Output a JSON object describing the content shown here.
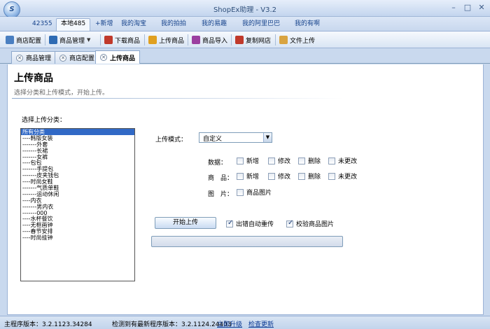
{
  "window": {
    "title": "ShopEx助理 - V3.2",
    "logo_text": ""
  },
  "menu": {
    "items": [
      {
        "label": "42355"
      },
      {
        "label": "本地485"
      },
      {
        "label": "+新增"
      },
      {
        "label": "我的淘宝"
      },
      {
        "label": "我的拍拍"
      },
      {
        "label": "我的易趣"
      },
      {
        "label": "我的阿里巴巴"
      },
      {
        "label": "我的有啊"
      }
    ]
  },
  "toolbar": {
    "items": [
      {
        "label": "商店配置",
        "icon": "store-config-icon",
        "color": "#4a7fc1"
      },
      {
        "label": "商品管理",
        "icon": "product-manage-icon",
        "color": "#2e6bb3"
      },
      {
        "label": "下载商品",
        "icon": "download-icon",
        "color": "#c0392b"
      },
      {
        "label": "上传商品",
        "icon": "upload-icon",
        "color": "#e0a020"
      },
      {
        "label": "商品导入",
        "icon": "import-icon",
        "color": "#9b3fa0"
      },
      {
        "label": "复制网店",
        "icon": "copy-store-icon",
        "color": "#c0392b"
      },
      {
        "label": "文件上传",
        "icon": "file-upload-icon",
        "color": "#d9a441"
      }
    ]
  },
  "doc_tabs": [
    {
      "label": "商品管理"
    },
    {
      "label": "商店配置"
    },
    {
      "label": "上传商品"
    }
  ],
  "page": {
    "title": "上传商品",
    "subtitle": "选择分类和上传模式，开始上传。"
  },
  "category": {
    "label": "选择上传分类：",
    "items": [
      "所有分类",
      "----韩版女装",
      "-------外套",
      "-------长裙",
      "-------女裤",
      "----包包",
      "-------手提包",
      "-------皮夹钱包",
      "----时尚女鞋",
      "-------气质单鞋",
      "-------运动休闲",
      "----内衣",
      "-------男内衣",
      "-------000",
      "----水杯餐饮",
      "----无框画钟",
      "----春节安排",
      "----时尚挂钟"
    ]
  },
  "upload_mode": {
    "label": "上传模式：",
    "value": "自定义"
  },
  "options": {
    "data_label": "数据：",
    "goods_label": "商　品：",
    "image_label": "图　片：",
    "data_opts": [
      "新增",
      "修改",
      "删除",
      "未更改"
    ],
    "goods_opts": [
      "新增",
      "修改",
      "删除",
      "未更改"
    ],
    "image_opt": "商品图片"
  },
  "actions": {
    "start": "开始上传",
    "auto_retry": "出错自动重传",
    "verify_image": "校验商品图片"
  },
  "status": {
    "version": "主程序版本：3.2.1123.34284",
    "latest": "检测到有最新程序版本：3.2.1124.24403",
    "upgrade": "立即升级",
    "check": "检查更新"
  }
}
